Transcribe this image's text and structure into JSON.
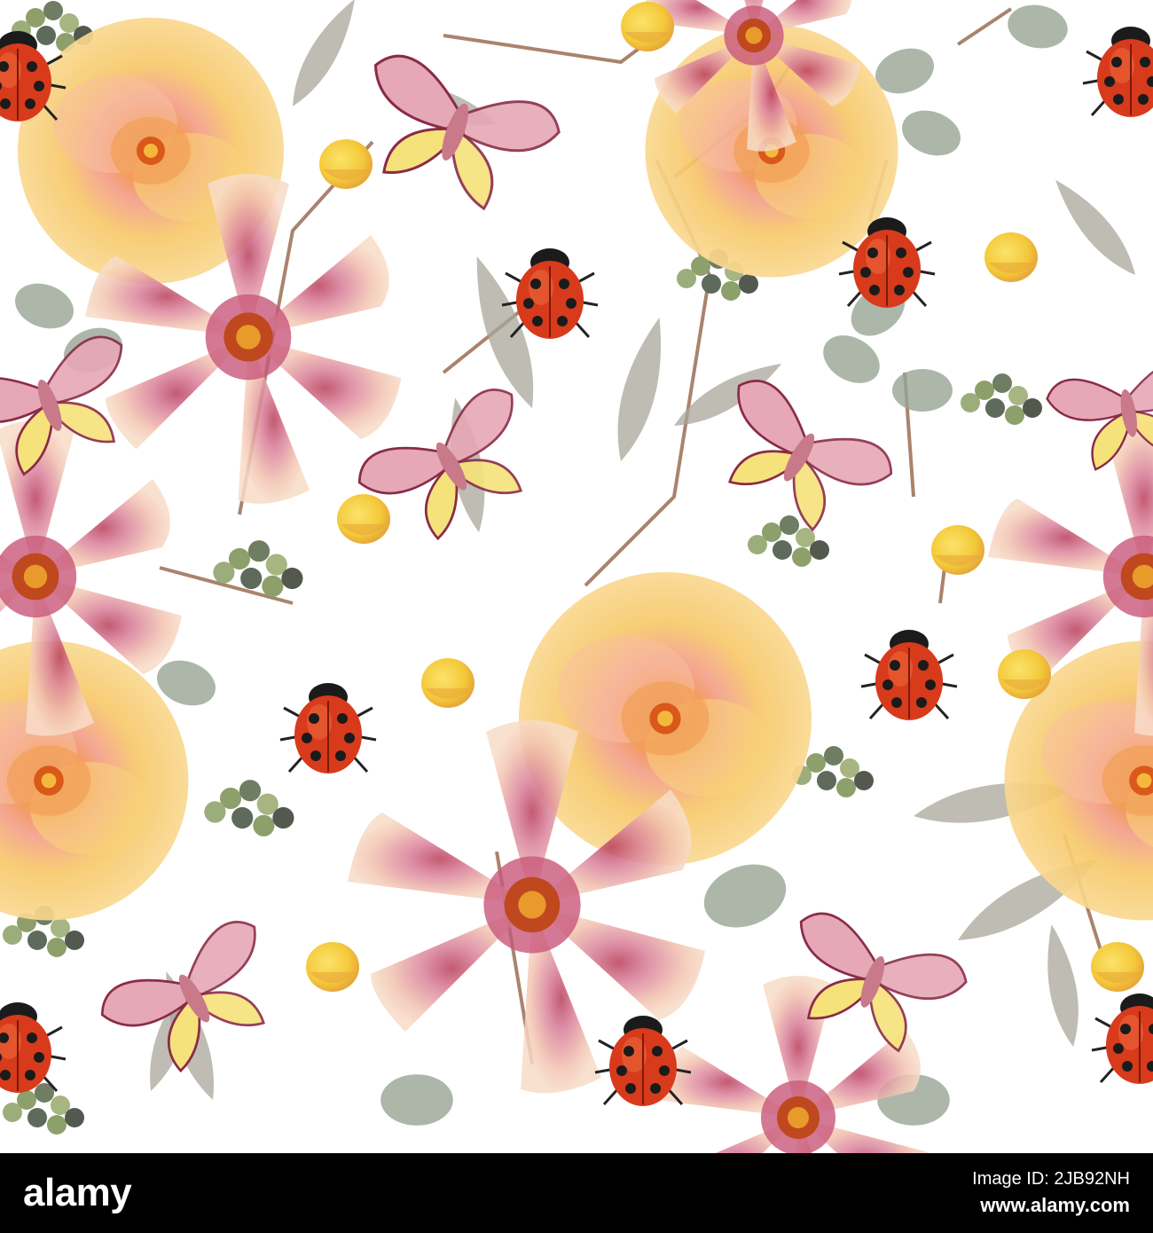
{
  "footer": {
    "brand": "alamy",
    "image_id_label": "Image ID: 2JB92NH",
    "site": "www.alamy.com"
  },
  "palette": {
    "background": "#ffffff",
    "footer": "#000000",
    "rose": "#f6c663",
    "rose_center": "#e2661f",
    "lily_petal": "#f3c9b4",
    "lily_pink": "#c8587a",
    "ladybug": "#d83a1c",
    "ladybug_head": "#1b1b1b",
    "leaf": "#a9a59a",
    "eucalyptus": "#97a595",
    "berry": "#8da06c",
    "bud": "#f4cd3c"
  }
}
